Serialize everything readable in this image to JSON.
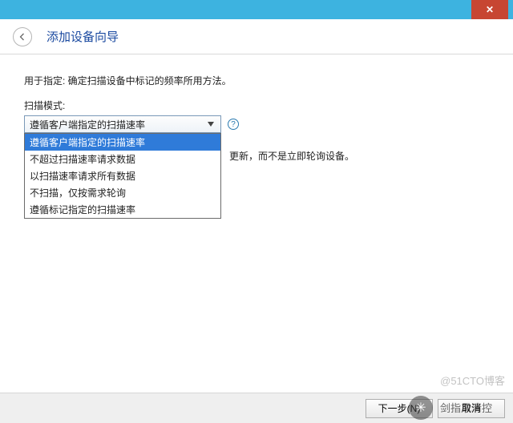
{
  "window": {
    "close_label": "✕"
  },
  "header": {
    "title": "添加设备向导"
  },
  "body": {
    "description": "用于指定: 确定扫描设备中标记的频率所用方法。",
    "scan_mode_label": "扫描模式:",
    "combo_selected": "遵循客户端指定的扫描速率",
    "help_symbol": "?",
    "dropdown": {
      "options": [
        "遵循客户端指定的扫描速率",
        "不超过扫描速率请求数据",
        "以扫描速率请求所有数据",
        "不扫描，仅按需求轮询",
        "遵循标记指定的扫描速率"
      ],
      "selected_index": 0
    },
    "hint_tail": "更新，而不是立即轮询设备。"
  },
  "footer": {
    "next_label": "下一步(N)",
    "cancel_label": "取消"
  },
  "watermark": {
    "top": "@51CTO博客",
    "circle": "✳",
    "bottom": "剑指风清控"
  }
}
